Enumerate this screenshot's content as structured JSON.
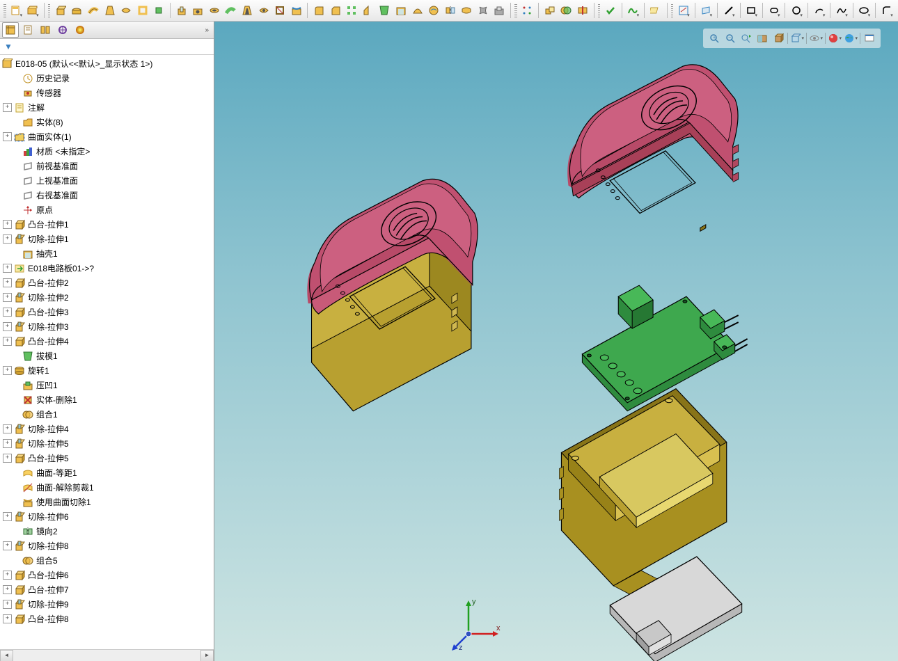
{
  "root_label": "E018-05  (默认<<默认>_显示状态 1>)",
  "axes": {
    "x": "x",
    "y": "y",
    "z": "z"
  },
  "tree": [
    {
      "exp": "",
      "ind": 1,
      "icon": "clock",
      "label": "历史记录"
    },
    {
      "exp": "",
      "ind": 1,
      "icon": "sensor",
      "label": "传感器"
    },
    {
      "exp": "+",
      "ind": 0,
      "icon": "note",
      "label": "注解"
    },
    {
      "exp": "",
      "ind": 1,
      "icon": "folder",
      "label": "实体(8)"
    },
    {
      "exp": "+",
      "ind": 0,
      "icon": "folder-sel",
      "label": "曲面实体(1)"
    },
    {
      "exp": "",
      "ind": 1,
      "icon": "material",
      "label": "材质 <未指定>"
    },
    {
      "exp": "",
      "ind": 1,
      "icon": "plane",
      "label": "前视基准面"
    },
    {
      "exp": "",
      "ind": 1,
      "icon": "plane",
      "label": "上视基准面"
    },
    {
      "exp": "",
      "ind": 1,
      "icon": "plane",
      "label": "右视基准面"
    },
    {
      "exp": "",
      "ind": 1,
      "icon": "origin",
      "label": "原点"
    },
    {
      "exp": "+",
      "ind": 0,
      "icon": "boss",
      "label": "凸台-拉伸1"
    },
    {
      "exp": "+",
      "ind": 0,
      "icon": "cut",
      "label": "切除-拉伸1"
    },
    {
      "exp": "",
      "ind": 1,
      "icon": "shell",
      "label": "抽壳1"
    },
    {
      "exp": "+",
      "ind": 0,
      "icon": "import",
      "label": "E018电路板01->?"
    },
    {
      "exp": "+",
      "ind": 0,
      "icon": "boss",
      "label": "凸台-拉伸2"
    },
    {
      "exp": "+",
      "ind": 0,
      "icon": "cut",
      "label": "切除-拉伸2"
    },
    {
      "exp": "+",
      "ind": 0,
      "icon": "boss",
      "label": "凸台-拉伸3"
    },
    {
      "exp": "+",
      "ind": 0,
      "icon": "cut",
      "label": "切除-拉伸3"
    },
    {
      "exp": "+",
      "ind": 0,
      "icon": "boss",
      "label": "凸台-拉伸4"
    },
    {
      "exp": "",
      "ind": 1,
      "icon": "draft",
      "label": "拔模1"
    },
    {
      "exp": "+",
      "ind": 0,
      "icon": "revolve",
      "label": "旋转1"
    },
    {
      "exp": "",
      "ind": 1,
      "icon": "indent",
      "label": "压凹1"
    },
    {
      "exp": "",
      "ind": 1,
      "icon": "delete",
      "label": "实体-删除1"
    },
    {
      "exp": "",
      "ind": 1,
      "icon": "combine",
      "label": "组合1"
    },
    {
      "exp": "+",
      "ind": 0,
      "icon": "cut",
      "label": "切除-拉伸4"
    },
    {
      "exp": "+",
      "ind": 0,
      "icon": "cut",
      "label": "切除-拉伸5"
    },
    {
      "exp": "+",
      "ind": 0,
      "icon": "boss",
      "label": "凸台-拉伸5"
    },
    {
      "exp": "",
      "ind": 1,
      "icon": "surf",
      "label": "曲面-等距1"
    },
    {
      "exp": "",
      "ind": 1,
      "icon": "surf2",
      "label": "曲面-解除剪裁1"
    },
    {
      "exp": "",
      "ind": 1,
      "icon": "surfcut",
      "label": "使用曲面切除1"
    },
    {
      "exp": "+",
      "ind": 0,
      "icon": "cut",
      "label": "切除-拉伸6"
    },
    {
      "exp": "",
      "ind": 1,
      "icon": "mirror",
      "label": "镜向2"
    },
    {
      "exp": "+",
      "ind": 0,
      "icon": "cut",
      "label": "切除-拉伸8"
    },
    {
      "exp": "",
      "ind": 1,
      "icon": "combine",
      "label": "组合5"
    },
    {
      "exp": "+",
      "ind": 0,
      "icon": "boss",
      "label": "凸台-拉伸6"
    },
    {
      "exp": "+",
      "ind": 0,
      "icon": "boss",
      "label": "凸台-拉伸7"
    },
    {
      "exp": "+",
      "ind": 0,
      "icon": "cut",
      "label": "切除-拉伸9"
    },
    {
      "exp": "+",
      "ind": 0,
      "icon": "boss",
      "label": "凸台-拉伸8"
    }
  ]
}
